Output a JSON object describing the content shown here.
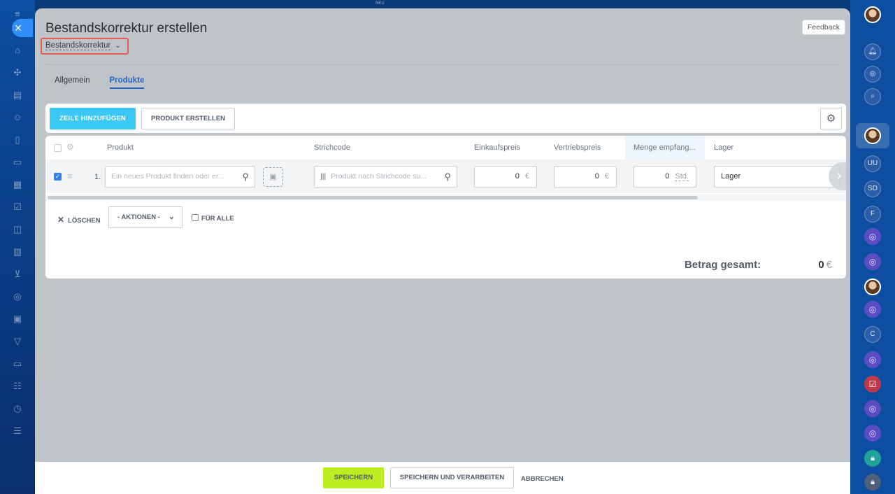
{
  "top_strip": {
    "badge": "NEU"
  },
  "header": {
    "title": "Bestandskorrektur erstellen",
    "doc_type": "Bestandskorrektur",
    "feedback": "Feedback"
  },
  "tabs": [
    {
      "label": "Allgemein",
      "active": false
    },
    {
      "label": "Produkte",
      "active": true
    }
  ],
  "toolbar": {
    "add_row": "ZEILE HINZUFÜGEN",
    "create_product": "PRODUKT ERSTELLEN"
  },
  "grid": {
    "columns": [
      "Produkt",
      "Strichcode",
      "Einkaufspreis",
      "Vertriebspreis",
      "Menge empfang...",
      "Lager"
    ],
    "row": {
      "number": "1.",
      "product_placeholder": "Ein neues Produkt finden oder er...",
      "barcode_placeholder": "Produkt nach Strichcode su...",
      "purchase_price": "0",
      "purchase_currency": "€",
      "sale_price": "0",
      "sale_currency": "€",
      "quantity": "0",
      "unit": "Std.",
      "store": "Lager"
    }
  },
  "actions": {
    "delete": "LÖSCHEN",
    "actions_select": "- AKTIONEN -",
    "for_all": "FÜR ALLE"
  },
  "totals": {
    "label": "Betrag gesamt:",
    "value": "0",
    "currency": "€"
  },
  "footer": {
    "save": "SPEICHERN",
    "save_process": "SPEICHERN UND VERARBEITEN",
    "cancel": "ABBRECHEN"
  },
  "right_rail": {
    "initials": [
      "UU",
      "SD",
      "F",
      "C"
    ]
  }
}
